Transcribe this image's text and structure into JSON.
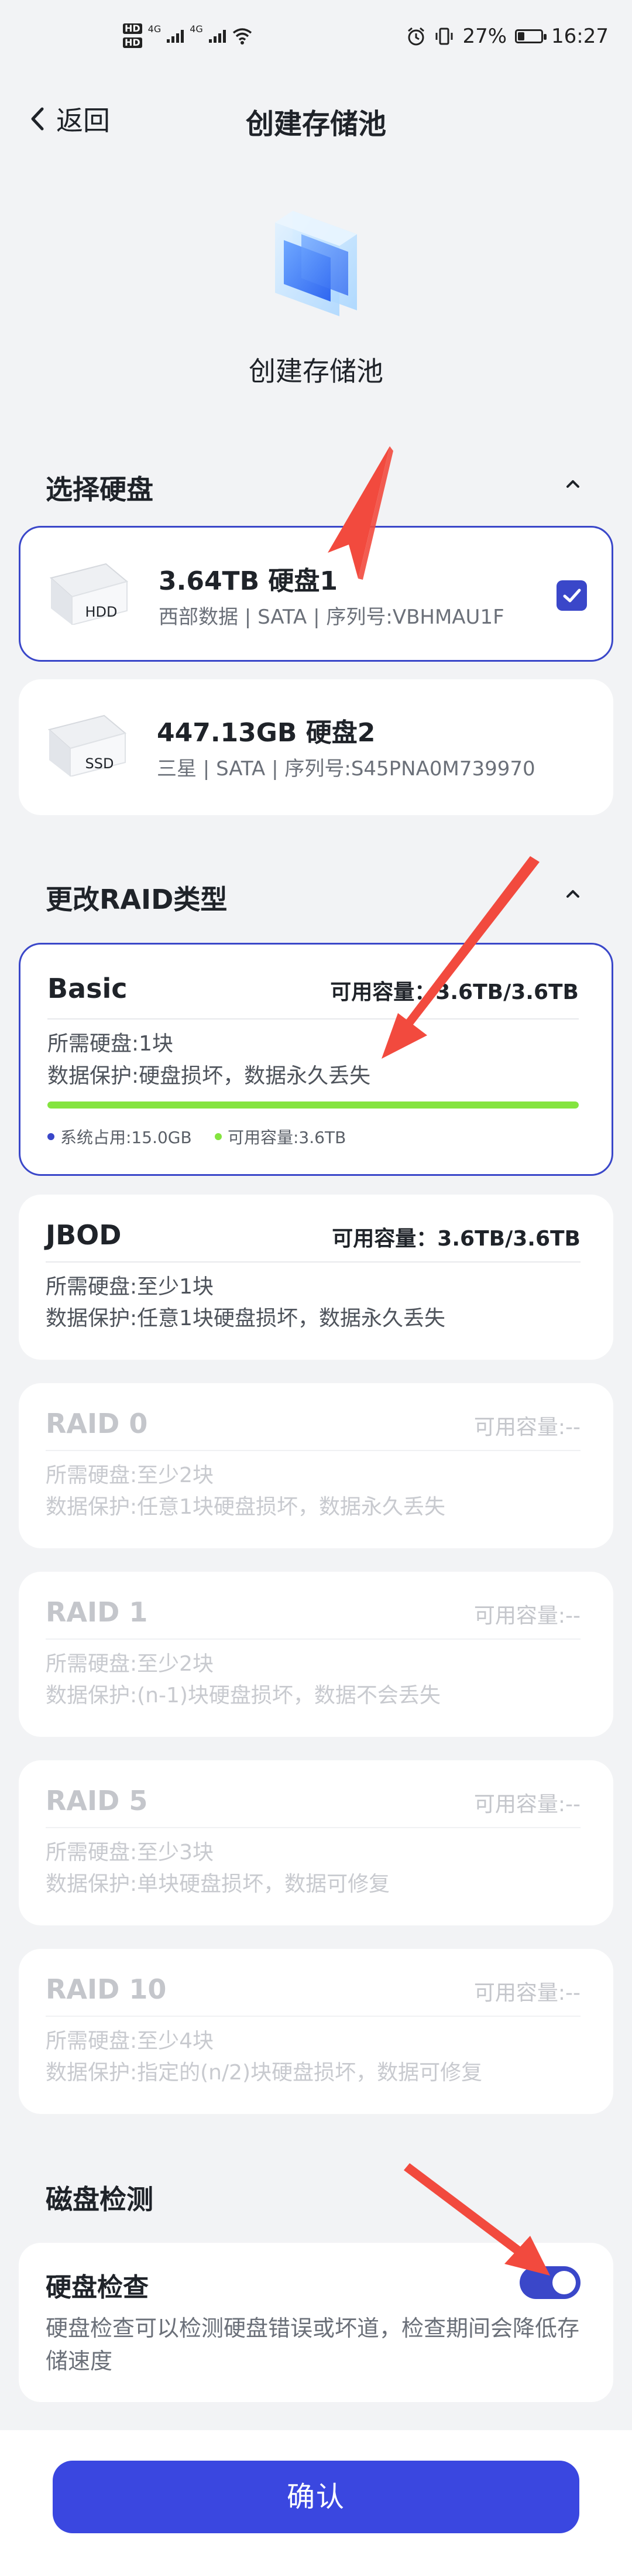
{
  "status_bar": {
    "hd1": "HD",
    "hd2": "HD",
    "net1": "4G",
    "net2": "4G",
    "battery_percent": "27%",
    "time": "16:27"
  },
  "nav": {
    "back_label": "返回",
    "title": "创建存储池"
  },
  "hero": {
    "label": "创建存储池"
  },
  "disk_section": {
    "title": "选择硬盘",
    "disks": [
      {
        "title": "3.64TB 硬盘1",
        "detail": "西部数据 | SATA | 序列号:VBHMAU1F",
        "type": "HDD",
        "selected": true
      },
      {
        "title": "447.13GB 硬盘2",
        "detail": "三星 | SATA | 序列号:S45PNA0M739970",
        "type": "SSD",
        "selected": false
      }
    ]
  },
  "raid_section": {
    "title": "更改RAID类型",
    "options": [
      {
        "name": "Basic",
        "capacity": "可用容量：3.6TB/3.6TB",
        "line1": "所需硬盘:1块",
        "line2": "数据保护:硬盘损坏，数据永久丢失",
        "selected": true,
        "usage": {
          "system_label": "系统占用:15.0GB",
          "available_label": "可用容量:3.6TB",
          "fill_fraction": 1.0
        }
      },
      {
        "name": "JBOD",
        "capacity": "可用容量：3.6TB/3.6TB",
        "line1": "所需硬盘:至少1块",
        "line2": "数据保护:任意1块硬盘损坏，数据永久丢失",
        "enabled": true
      },
      {
        "name": "RAID 0",
        "capacity": "可用容量:--",
        "line1": "所需硬盘:至少2块",
        "line2": "数据保护:任意1块硬盘损坏，数据永久丢失",
        "enabled": false
      },
      {
        "name": "RAID 1",
        "capacity": "可用容量:--",
        "line1": "所需硬盘:至少2块",
        "line2": "数据保护:(n-1)块硬盘损坏，数据不会丢失",
        "enabled": false
      },
      {
        "name": "RAID 5",
        "capacity": "可用容量:--",
        "line1": "所需硬盘:至少3块",
        "line2": "数据保护:单块硬盘损坏，数据可修复",
        "enabled": false
      },
      {
        "name": "RAID 10",
        "capacity": "可用容量:--",
        "line1": "所需硬盘:至少4块",
        "line2": "数据保护:指定的(n/2)块硬盘损坏，数据可修复",
        "enabled": false
      }
    ]
  },
  "disk_check": {
    "section_title": "磁盘检测",
    "title": "硬盘检查",
    "description": "硬盘检查可以检测硬盘错误或坏道，检查期间会降低存储速度",
    "enabled": true
  },
  "confirm_label": "确认",
  "colors": {
    "accent": "#3a47c9",
    "button": "#3a47e0",
    "usage_green": "#84e43f",
    "annotation_red": "#f24a3e"
  }
}
